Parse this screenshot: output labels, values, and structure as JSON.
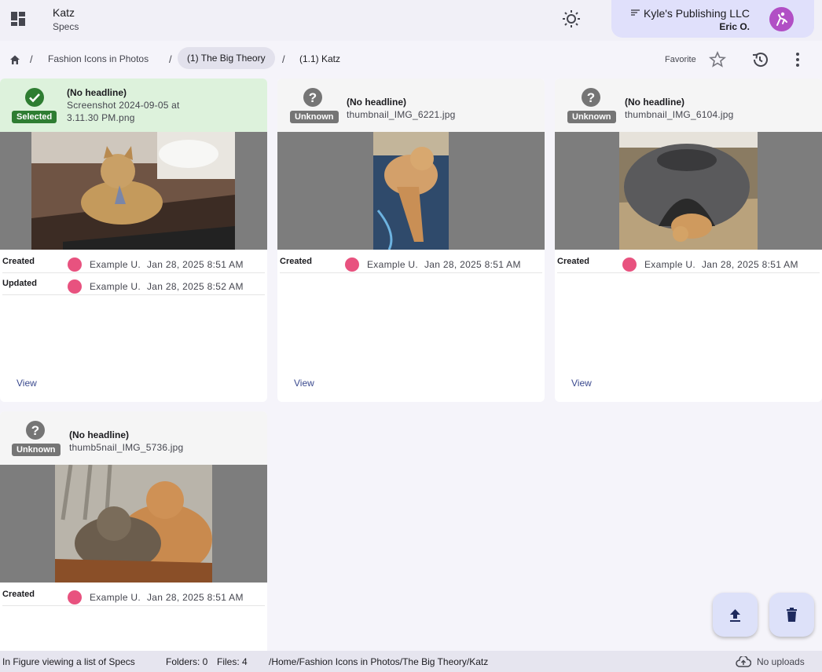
{
  "header": {
    "title": "Katz",
    "subtitle": "Specs",
    "org_name": "Kyle's Publishing LLC",
    "user_name": "Eric O.",
    "icons": [
      "apps-icon",
      "brightness-icon",
      "sort-icon",
      "avatar-icon"
    ]
  },
  "breadcrumb": {
    "items": [
      "Fashion Icons in Photos",
      "(1) The Big Theory",
      "(1.1) Katz"
    ],
    "separator": "/",
    "favorite_label": "Favorite"
  },
  "cards": [
    {
      "status": "Selected",
      "headline": "(No headline)",
      "filename_line1": "Screenshot 2024-09-05 at",
      "filename_line2": "3.11.30 PM.png",
      "meta": [
        {
          "label": "Created",
          "user": "Example U.",
          "date": "Jan 28, 2025 8:51 AM"
        },
        {
          "label": "Updated",
          "user": "Example U.",
          "date": "Jan 28, 2025 8:52 AM"
        }
      ],
      "view_label": "View"
    },
    {
      "status": "Unknown",
      "headline": "(No headline)",
      "filename_line1": "thumbnail_IMG_6221.jpg",
      "meta": [
        {
          "label": "Created",
          "user": "Example U.",
          "date": "Jan 28, 2025 8:51 AM"
        }
      ],
      "view_label": "View"
    },
    {
      "status": "Unknown",
      "headline": "(No headline)",
      "filename_line1": "thumbnail_IMG_6104.jpg",
      "meta": [
        {
          "label": "Created",
          "user": "Example U.",
          "date": "Jan 28, 2025 8:51 AM"
        }
      ],
      "view_label": "View"
    },
    {
      "status": "Unknown",
      "headline": "(No headline)",
      "filename_line1": "thumb5nail_IMG_5736.jpg",
      "meta": [
        {
          "label": "Created",
          "user": "Example U.",
          "date": "Jan 28, 2025 8:51 AM"
        }
      ],
      "view_label": "View"
    }
  ],
  "statusbar": {
    "context": "In Figure viewing a list of Specs",
    "folders": "Folders: 0",
    "files": "Files: 4",
    "path": "/Home/Fashion Icons in Photos/The Big Theory/Katz",
    "uploads": "No uploads"
  },
  "colors": {
    "accent": "#3b4a8f",
    "selected_bg": "#ddf2dc",
    "selected_badge": "#2e7d32",
    "unknown_badge": "#757575",
    "org_chip": "#e0e0fb",
    "user_avatar": "#e8527f"
  }
}
